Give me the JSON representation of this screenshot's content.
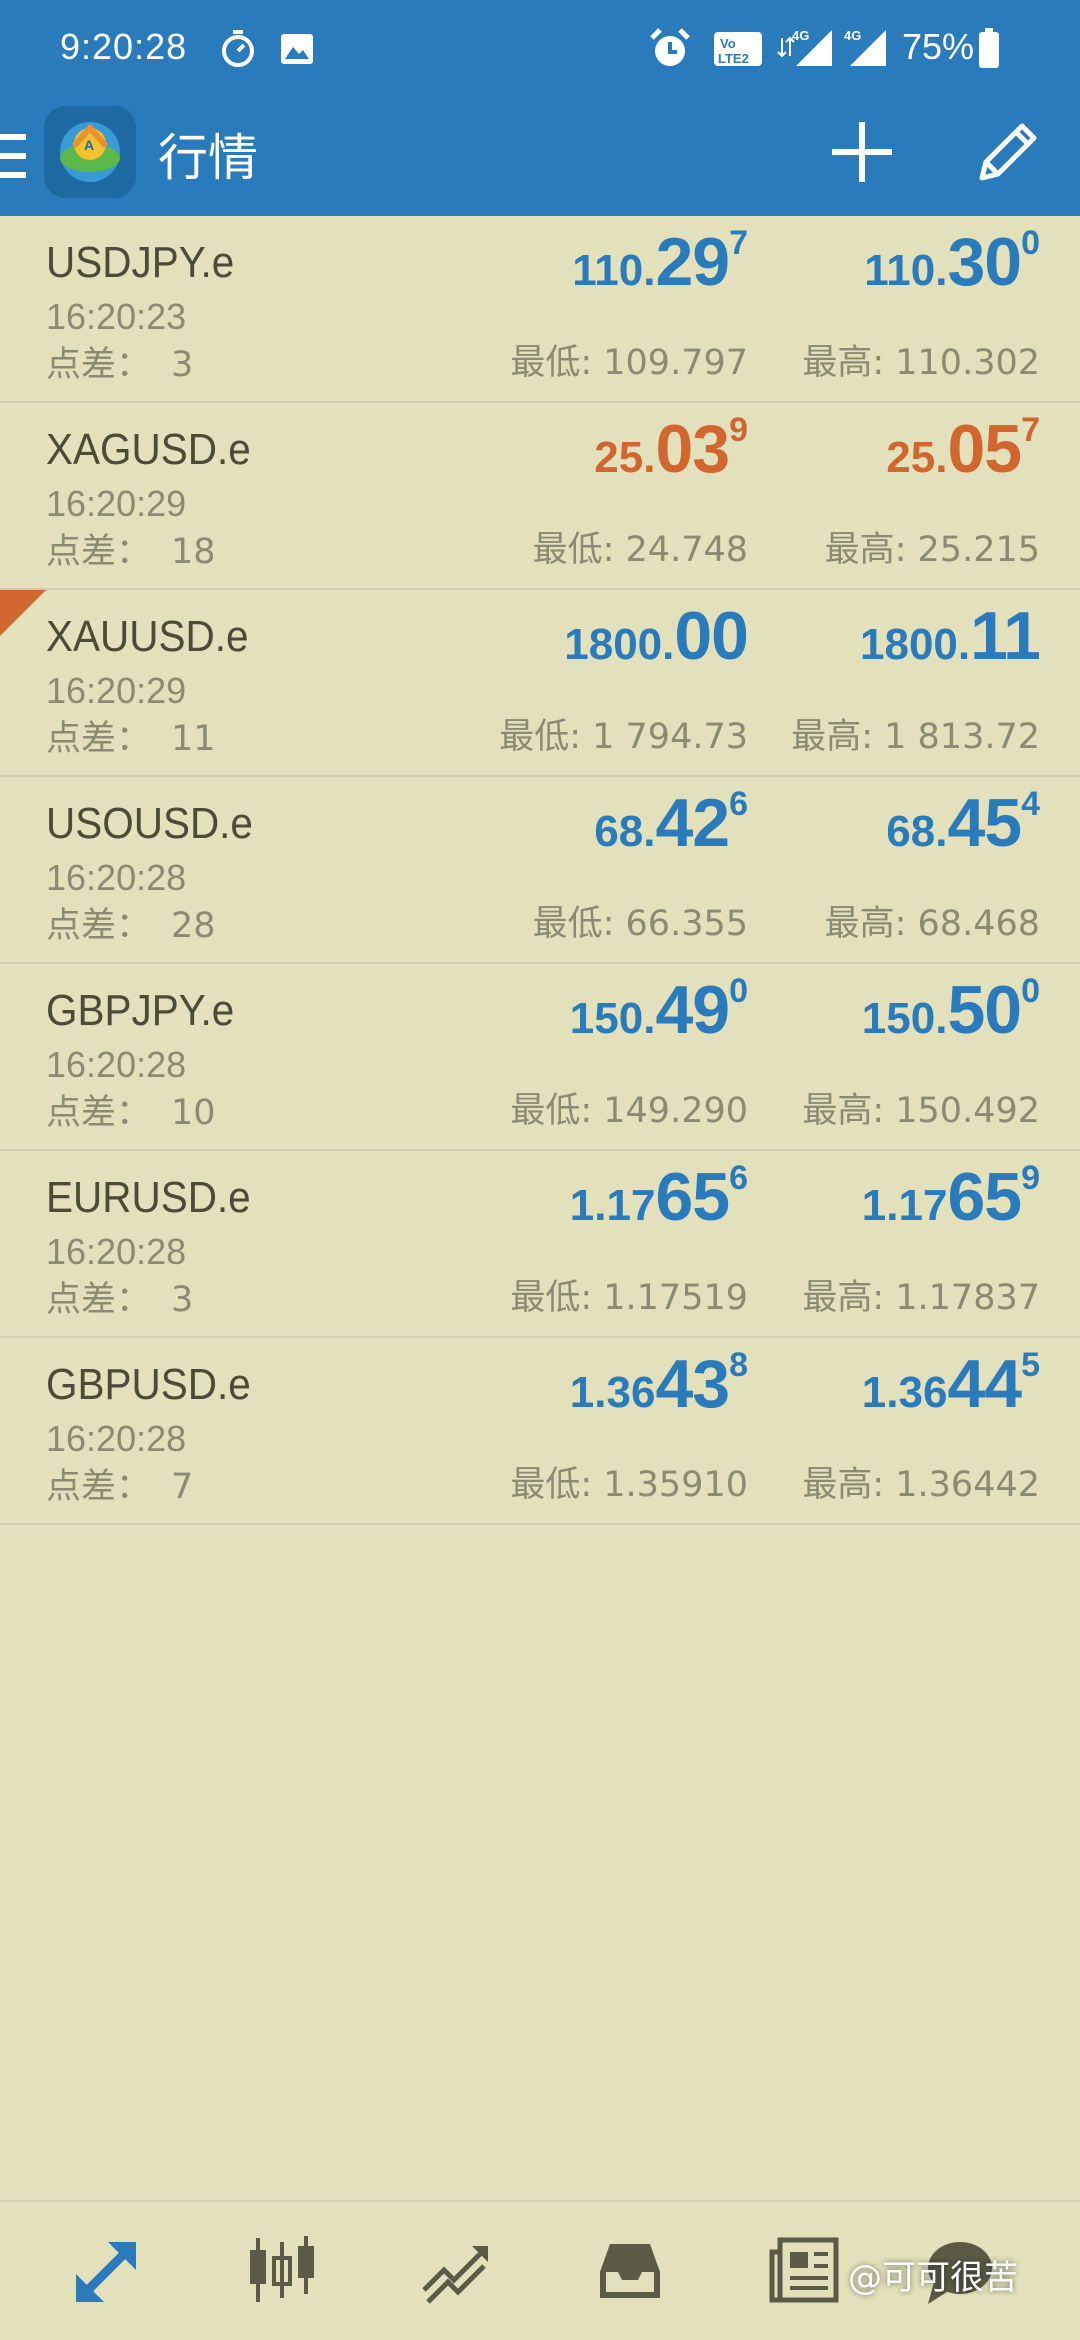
{
  "status_bar": {
    "time": "9:20:28",
    "battery": "75%",
    "icons": [
      "stopwatch-icon",
      "gallery-icon",
      "alarm-icon",
      "volte-icon",
      "signal-4g-icon",
      "signal-4g-icon",
      "battery-icon"
    ]
  },
  "app_bar": {
    "title": "行情",
    "icons": [
      "menu-icon",
      "app-logo-icon",
      "add-icon",
      "edit-icon"
    ]
  },
  "labels": {
    "spread": "点差：",
    "low": "最低:",
    "high": "最高:"
  },
  "colors": {
    "header": "#2a7bbc",
    "background": "#e2e1bb",
    "price_up": "#2a7bbc",
    "price_down": "#d2662f"
  },
  "quotes": [
    {
      "symbol": "USDJPY.e",
      "time": "16:20:23",
      "spread": "3",
      "color": "blue",
      "bid": {
        "small": "110.",
        "big": "29",
        "sup": "7"
      },
      "ask": {
        "small": "110.",
        "big": "30",
        "sup": "0"
      },
      "low": "109.797",
      "high": "110.302"
    },
    {
      "symbol": "XAGUSD.e",
      "time": "16:20:29",
      "spread": "18",
      "color": "orange",
      "bid": {
        "small": "25.",
        "big": "03",
        "sup": "9"
      },
      "ask": {
        "small": "25.",
        "big": "05",
        "sup": "7"
      },
      "low": "24.748",
      "high": "25.215"
    },
    {
      "symbol": "XAUUSD.e",
      "time": "16:20:29",
      "spread": "11",
      "color": "blue",
      "flag": true,
      "bid": {
        "small": "1800.",
        "big": "00",
        "sup": ""
      },
      "ask": {
        "small": "1800.",
        "big": "11",
        "sup": ""
      },
      "low": "1 794.73",
      "high": "1 813.72"
    },
    {
      "symbol": "USOUSD.e",
      "time": "16:20:28",
      "spread": "28",
      "color": "blue",
      "bid": {
        "small": "68.",
        "big": "42",
        "sup": "6"
      },
      "ask": {
        "small": "68.",
        "big": "45",
        "sup": "4"
      },
      "low": "66.355",
      "high": "68.468"
    },
    {
      "symbol": "GBPJPY.e",
      "time": "16:20:28",
      "spread": "10",
      "color": "blue",
      "bid": {
        "small": "150.",
        "big": "49",
        "sup": "0"
      },
      "ask": {
        "small": "150.",
        "big": "50",
        "sup": "0"
      },
      "low": "149.290",
      "high": "150.492"
    },
    {
      "symbol": "EURUSD.e",
      "time": "16:20:28",
      "spread": "3",
      "color": "blue",
      "bid": {
        "small": "1.17",
        "big": "65",
        "sup": "6"
      },
      "ask": {
        "small": "1.17",
        "big": "65",
        "sup": "9"
      },
      "low": "1.17519",
      "high": "1.17837"
    },
    {
      "symbol": "GBPUSD.e",
      "time": "16:20:28",
      "spread": "7",
      "color": "blue",
      "bid": {
        "small": "1.36",
        "big": "43",
        "sup": "8"
      },
      "ask": {
        "small": "1.36",
        "big": "44",
        "sup": "5"
      },
      "low": "1.35910",
      "high": "1.36442"
    }
  ],
  "bottom_nav": {
    "items": [
      "quotes-icon",
      "charts-icon",
      "trade-icon",
      "history-icon",
      "news-icon",
      "chat-icon"
    ]
  },
  "watermark": "@可可很苦"
}
